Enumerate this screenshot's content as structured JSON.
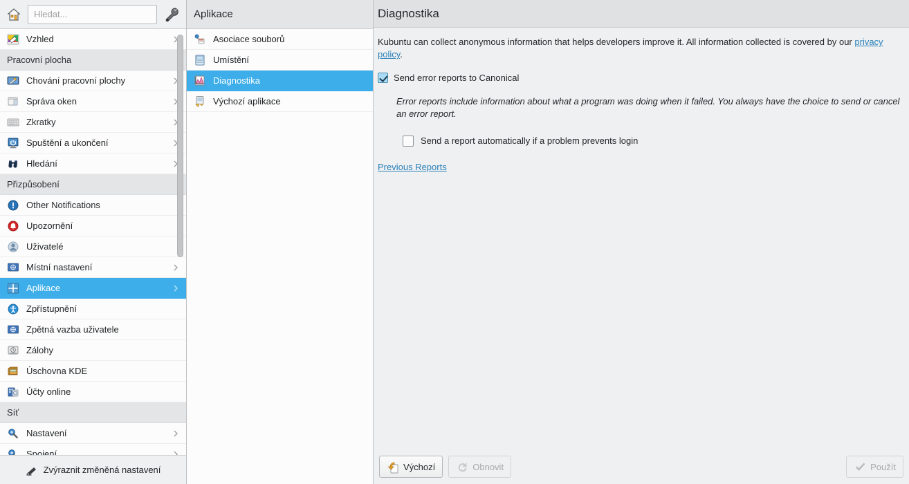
{
  "toolbar": {
    "home_tooltip": "Home",
    "search_placeholder": "Hledat...",
    "configure_tooltip": "Configure"
  },
  "sidebar": {
    "highlight_changed_label": "Zvýraznit změněná nastavení",
    "rows": [
      {
        "type": "item",
        "label": "Vzhled",
        "icon": "appearance-icon",
        "chevron": true,
        "selected": false
      },
      {
        "type": "header",
        "label": "Pracovní plocha"
      },
      {
        "type": "item",
        "label": "Chování pracovní plochy",
        "icon": "desktop-behavior-icon",
        "chevron": true,
        "selected": false
      },
      {
        "type": "item",
        "label": "Správa oken",
        "icon": "window-management-icon",
        "chevron": true,
        "selected": false
      },
      {
        "type": "item",
        "label": "Zkratky",
        "icon": "shortcuts-icon",
        "chevron": true,
        "selected": false
      },
      {
        "type": "item",
        "label": "Spuštění a ukončení",
        "icon": "startup-shutdown-icon",
        "chevron": true,
        "selected": false
      },
      {
        "type": "item",
        "label": "Hledání",
        "icon": "search-binoculars-icon",
        "chevron": true,
        "selected": false
      },
      {
        "type": "header",
        "label": "Přizpůsobení"
      },
      {
        "type": "item",
        "label": "Other Notifications",
        "icon": "notifications-icon",
        "chevron": false,
        "selected": false
      },
      {
        "type": "item",
        "label": "Upozornění",
        "icon": "alert-bell-icon",
        "chevron": false,
        "selected": false
      },
      {
        "type": "item",
        "label": "Uživatelé",
        "icon": "users-icon",
        "chevron": false,
        "selected": false
      },
      {
        "type": "item",
        "label": "Místní nastavení",
        "icon": "locale-flag-icon",
        "chevron": true,
        "selected": false
      },
      {
        "type": "item",
        "label": "Aplikace",
        "icon": "applications-icon",
        "chevron": true,
        "selected": true
      },
      {
        "type": "item",
        "label": "Zpřístupnění",
        "icon": "accessibility-icon",
        "chevron": false,
        "selected": false
      },
      {
        "type": "item",
        "label": "Zpětná vazba uživatele",
        "icon": "user-feedback-icon",
        "chevron": false,
        "selected": false
      },
      {
        "type": "item",
        "label": "Zálohy",
        "icon": "backups-icon",
        "chevron": false,
        "selected": false
      },
      {
        "type": "item",
        "label": "Úschovna KDE",
        "icon": "kde-wallet-icon",
        "chevron": false,
        "selected": false
      },
      {
        "type": "item",
        "label": "Účty online",
        "icon": "online-accounts-icon",
        "chevron": false,
        "selected": false
      },
      {
        "type": "header",
        "label": "Síť"
      },
      {
        "type": "item",
        "label": "Nastavení",
        "icon": "network-settings-icon",
        "chevron": true,
        "selected": false
      },
      {
        "type": "item",
        "label": "Spojení",
        "icon": "network-connections-icon",
        "chevron": true,
        "selected": false
      }
    ]
  },
  "midpanel": {
    "title": "Aplikace",
    "items": [
      {
        "label": "Asociace souborů",
        "icon": "file-associations-icon",
        "selected": false
      },
      {
        "label": "Umístění",
        "icon": "locations-icon",
        "selected": false
      },
      {
        "label": "Diagnostika",
        "icon": "diagnostics-icon",
        "selected": true
      },
      {
        "label": "Výchozí aplikace",
        "icon": "default-applications-icon",
        "selected": false
      }
    ]
  },
  "main": {
    "title": "Diagnostika",
    "intro_text": "Kubuntu can collect anonymous information that helps developers improve it. All information collected is covered by our ",
    "intro_link": "privacy policy",
    "intro_tail": ".",
    "send_reports_label": "Send error reports to Canonical",
    "send_reports_checked": true,
    "error_reports_desc": "Error reports include information about what a program was doing when it failed. You always have the choice to send or cancel an error report.",
    "auto_report_label": "Send a report automatically if a problem prevents login",
    "auto_report_checked": false,
    "previous_reports_link": "Previous Reports",
    "buttons": {
      "defaults": "Výchozí",
      "reset": "Obnovit",
      "apply": "Použít"
    }
  },
  "colors": {
    "selection": "#3daee9",
    "link": "#2980b9",
    "window": "#eff0f1",
    "base": "#fcfcfc",
    "header": "#e4e5e7"
  }
}
